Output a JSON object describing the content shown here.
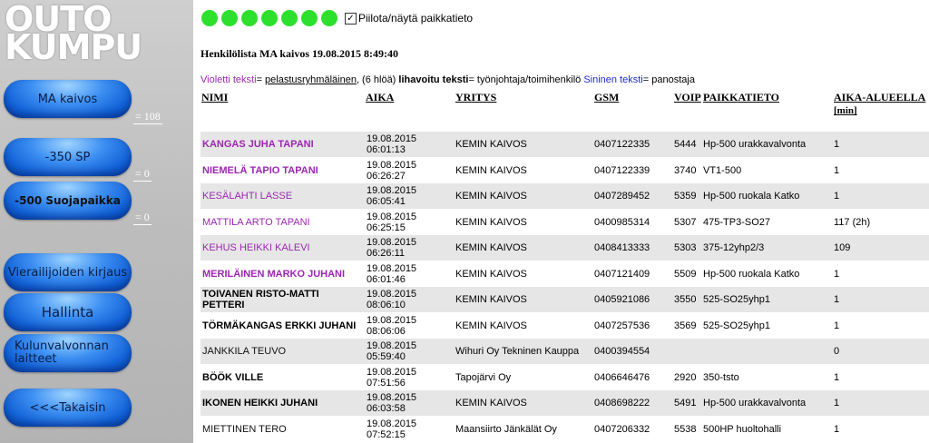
{
  "logo": {
    "line1": "OUTO",
    "line2": "KUMPU"
  },
  "sidebar": {
    "buttons": [
      {
        "label": "MA kaivos",
        "count": "= 108"
      },
      {
        "label": "-350 SP",
        "count": "= 0"
      },
      {
        "label": "-500 Suojapaikka",
        "count": "= 0"
      },
      {
        "label": "Vierailijoiden kirjaus"
      },
      {
        "label": "Hallinta"
      },
      {
        "label": "Kulunvalvonnan laitteet"
      },
      {
        "label": "<<<Takaisin"
      }
    ]
  },
  "status": {
    "dot_count": 7,
    "dot_color": "#2ee02e",
    "checkbox_label": "Piilota/näytä paikkatieto",
    "checked": true
  },
  "title": "Henkilölista MA kaivos 19.08.2015 8:49:40",
  "legend": {
    "violet_label": "Violetti teksti",
    "violet_eq": "= ",
    "violet_desc": "pelastusryhmäläinen",
    "count_text": ", (6 hlöä) ",
    "bold_label": "lihavoitu teksti",
    "bold_desc": "= työnjohtaja/toimihenkilö ",
    "blue_label": "Sininen teksti",
    "blue_desc": "= panostaja"
  },
  "columns": {
    "name": "NIMI",
    "aika": "AIKA",
    "yritys": "YRITYS",
    "gsm": "GSM",
    "voip": "VOIP",
    "paikkatieto": "PAIKKATIETO",
    "aika_alueella": "AIKA-ALUEELLA",
    "aika_alueella_unit": "[min]"
  },
  "rows": [
    {
      "name": "KANGAS JUHA TAPANI",
      "style": "violet-bold",
      "date": "19.08.2015",
      "time": "06:01:13",
      "company": "KEMIN KAIVOS",
      "gsm": "0407122335",
      "voip": "5444",
      "location": "Hp-500 urakkavalvonta",
      "minutes": "1"
    },
    {
      "name": "NIEMELÄ TAPIO TAPANI",
      "style": "violet-bold",
      "date": "19.08.2015",
      "time": "06:26:27",
      "company": "KEMIN KAIVOS",
      "gsm": "0407122339",
      "voip": "3740",
      "location": "VT1-500",
      "minutes": "1"
    },
    {
      "name": "KESÄLAHTI LASSE",
      "style": "violet",
      "date": "19.08.2015",
      "time": "06:05:41",
      "company": "KEMIN KAIVOS",
      "gsm": "0407289452",
      "voip": "5359",
      "location": "Hp-500 ruokala Katko",
      "minutes": "1"
    },
    {
      "name": "MATTILA ARTO TAPANI",
      "style": "violet",
      "date": "19.08.2015",
      "time": "06:25:15",
      "company": "KEMIN KAIVOS",
      "gsm": "0400985314",
      "voip": "5307",
      "location": "475-TP3-SO27",
      "minutes": "117 (2h)"
    },
    {
      "name": "KEHUS HEIKKI KALEVI",
      "style": "violet",
      "date": "19.08.2015",
      "time": "06:26:11",
      "company": "KEMIN KAIVOS",
      "gsm": "0408413333",
      "voip": "5303",
      "location": "375-12yhp2/3",
      "minutes": "109"
    },
    {
      "name": "MERILÄINEN MARKO JUHANI",
      "style": "violet-bold",
      "date": "19.08.2015",
      "time": "06:01:46",
      "company": "KEMIN KAIVOS",
      "gsm": "0407121409",
      "voip": "5509",
      "location": "Hp-500 ruokala Katko",
      "minutes": "1"
    },
    {
      "name": "TOIVANEN RISTO-MATTI PETTERI",
      "style": "bold",
      "date": "19.08.2015",
      "time": "08:06:10",
      "company": "KEMIN KAIVOS",
      "gsm": "0405921086",
      "voip": "3550",
      "location": "525-SO25yhp1",
      "minutes": "1"
    },
    {
      "name": "TÖRMÄKANGAS ERKKI JUHANI",
      "style": "bold",
      "date": "19.08.2015",
      "time": "08:06:06",
      "company": "KEMIN KAIVOS",
      "gsm": "0407257536",
      "voip": "3569",
      "location": "525-SO25yhp1",
      "minutes": "1"
    },
    {
      "name": "JANKKILA TEUVO",
      "style": "plain",
      "date": "19.08.2015",
      "time": "05:59:40",
      "company": "Wihuri Oy Tekninen Kauppa",
      "gsm": "0400394554",
      "voip": "",
      "location": "",
      "minutes": "0"
    },
    {
      "name": "BÖÖK VILLE",
      "style": "bold",
      "date": "19.08.2015",
      "time": "07:51:56",
      "company": "Tapojärvi Oy",
      "gsm": "0406646476",
      "voip": "2920",
      "location": "350-tsto",
      "minutes": "1"
    },
    {
      "name": "IKONEN HEIKKI JUHANI",
      "style": "bold",
      "date": "19.08.2015",
      "time": "06:03:58",
      "company": "KEMIN KAIVOS",
      "gsm": "0408698222",
      "voip": "5491",
      "location": "Hp-500 urakkavalvonta",
      "minutes": "1"
    },
    {
      "name": "MIETTINEN TERO",
      "style": "plain",
      "date": "19.08.2015",
      "time": "07:52:15",
      "company": "Maansiirto Jänkälät Oy",
      "gsm": "0407206332",
      "voip": "5538",
      "location": "500HP huoltohalli",
      "minutes": "1"
    }
  ]
}
